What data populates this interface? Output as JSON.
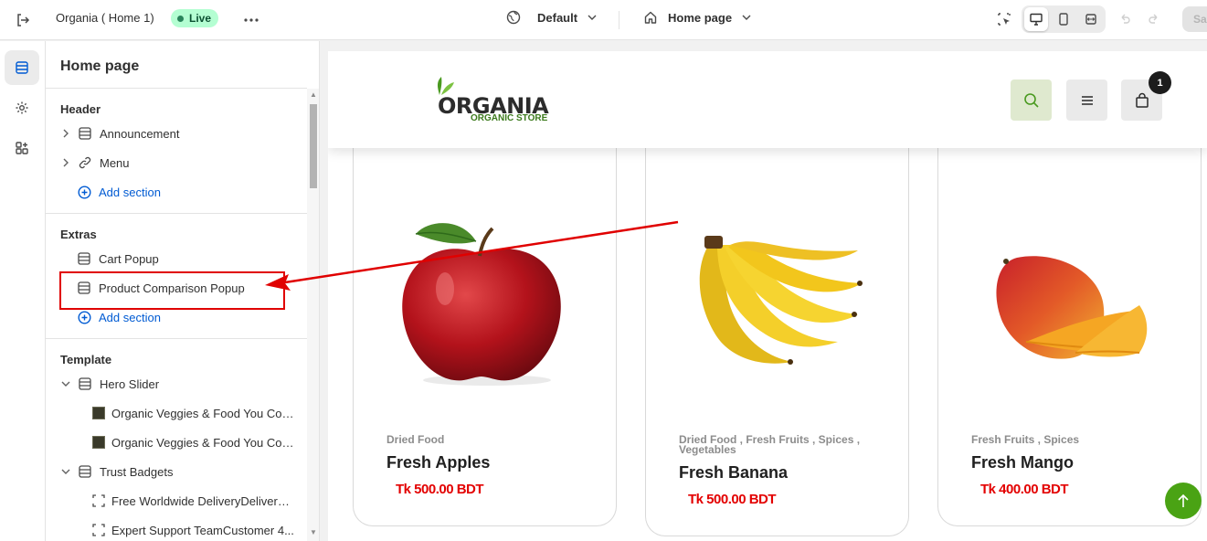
{
  "topbar": {
    "store_title": "Organia ( Home 1)",
    "live_badge": "Live",
    "theme_dropdown": "Default",
    "page_dropdown": "Home page",
    "save_label": "Sa"
  },
  "sidebar": {
    "title": "Home page",
    "sections": {
      "header": {
        "label": "Header",
        "items": [
          "Announcement",
          "Menu"
        ],
        "add_label": "Add section"
      },
      "extras": {
        "label": "Extras",
        "items": [
          "Cart Popup",
          "Product Comparison Popup"
        ],
        "add_label": "Add section"
      },
      "template": {
        "label": "Template",
        "hero_slider": "Hero Slider",
        "hero_items": [
          "Organic Veggies & Food You Coo...",
          "Organic Veggies & Food You Coo..."
        ],
        "trust_badges": "Trust Badgets",
        "trust_items": [
          "Free Worldwide DeliveryDelivery ...",
          "Expert Support TeamCustomer 4..."
        ]
      }
    }
  },
  "preview": {
    "logo": {
      "main": "ORGANIA",
      "sub": "ORGANIC STORE"
    },
    "cart_count": "1",
    "products": [
      {
        "category": "Dried Food",
        "name": "Fresh Apples",
        "price": "Tk 500.00 BDT"
      },
      {
        "category": "Dried Food , Fresh Fruits , Spices , Vegetables",
        "name": "Fresh Banana",
        "price": "Tk 500.00 BDT"
      },
      {
        "category": "Fresh Fruits , Spices",
        "name": "Fresh Mango",
        "price": "Tk 400.00 BDT"
      }
    ]
  },
  "colors": {
    "accent_link": "#005bd3",
    "live_badge_bg": "#b4fed2",
    "price_red": "#e30000",
    "annotation_red": "#e00000",
    "brand_green": "#4aa314"
  }
}
